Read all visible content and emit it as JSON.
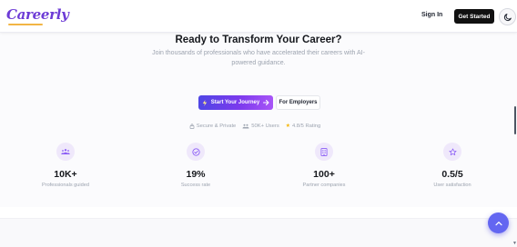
{
  "header": {
    "logo_text": "Careerly",
    "signin_label": "Sign In",
    "get_started_label": "Get Started",
    "theme_icon": "moon-icon"
  },
  "cta": {
    "title": "Ready to Transform Your Career?",
    "subtitle": "Join thousands of professionals who have accelerated their careers with AI-powered guidance.",
    "primary_button": "Start Your Journey",
    "secondary_button": "For Employers",
    "trust_badges": [
      {
        "icon": "lock-icon",
        "label": "Secure & Private"
      },
      {
        "icon": "users-icon",
        "label": "50K+ Users"
      },
      {
        "icon": "star-icon",
        "label": "4.8/5 Rating"
      }
    ]
  },
  "stats": [
    {
      "icon": "users-icon",
      "value": "10K+",
      "label": "Professionals guided"
    },
    {
      "icon": "check-circle-icon",
      "value": "19%",
      "label": "Success rate"
    },
    {
      "icon": "building-icon",
      "value": "100+",
      "label": "Partner companies"
    },
    {
      "icon": "star-outline-icon",
      "value": "0.5/5",
      "label": "User satisfaction"
    }
  ],
  "colors": {
    "brand": "#6d3bd6",
    "accent_gradient_start": "#4f46e5",
    "accent_gradient_end": "#a855f7",
    "icon_tint": "#efe8fb",
    "fab": "#6366f1"
  },
  "fab": {
    "icon": "chevron-up-icon"
  }
}
